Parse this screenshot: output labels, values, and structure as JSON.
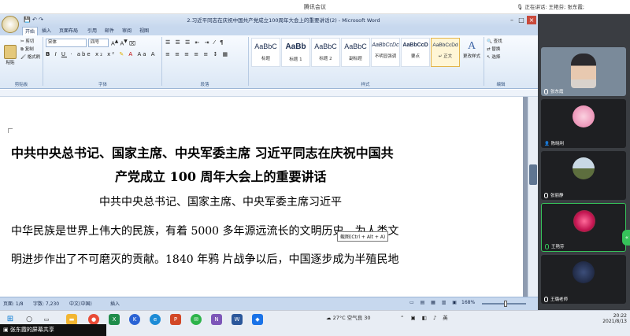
{
  "meeting": {
    "app_title": "腾讯会议",
    "speaking_label": "正在讲话: 王艳芬; 张东霞;"
  },
  "word": {
    "doc_title": "2.习近平同志在庆祝中国共产党成立100周年大会上的重要讲话(2) - Microsoft Word",
    "tabs": [
      "开始",
      "插入",
      "页面布局",
      "引用",
      "邮件",
      "审阅",
      "视图"
    ],
    "active_tab": "开始",
    "clipboard": {
      "paste": "粘贴",
      "cut": "剪切",
      "copy": "复制",
      "format_painter": "格式刷",
      "group": "剪贴板"
    },
    "font": {
      "name": "宋体",
      "size": "四号",
      "group": "字体"
    },
    "paragraph": {
      "group": "段落"
    },
    "styles": {
      "group": "样式",
      "items": [
        {
          "sample": "AaBbC",
          "name": "标题"
        },
        {
          "sample": "AaBb",
          "name": "标题 1"
        },
        {
          "sample": "AaBbC",
          "name": "标题 2"
        },
        {
          "sample": "AaBbC",
          "name": "副标题"
        },
        {
          "sample": "AaBbCcDc",
          "name": "不明显强调"
        },
        {
          "sample": "AaBbCcD",
          "name": "要点"
        },
        {
          "sample": "AaBbCcDd",
          "name": "↵ 正文"
        }
      ],
      "change_styles": "更改样式"
    },
    "editing": {
      "find": "查找",
      "replace": "替换",
      "select": "选择",
      "group": "编辑"
    },
    "document": {
      "heading_line1": "中共中央总书记、国家主席、中央军委主席 习近平同志在庆祝中国共",
      "heading_line2": "产党成立 100 周年大会上的重要讲话",
      "byline": "中共中央总书记、国家主席、中央军委主席习近平",
      "para_line1": "中华民族是世界上伟大的民族，有着 5000 多年源远流长的文明历史，为人类文",
      "para_line2": "明进步作出了不可磨灭的贡献。1840 年鸦 片战争以后，中国逐步成为半殖民地"
    },
    "tooltip": "截图(Ctrl + Alt + A)",
    "status": {
      "page": "页面: 1/8",
      "words": "字数: 7,230",
      "language": "中文(中国)",
      "mode": "插入",
      "zoom": "168%"
    }
  },
  "participants": [
    {
      "name": "张东霞",
      "kind": "video"
    },
    {
      "name": "陈晓利",
      "kind": "flower"
    },
    {
      "name": "张丽静",
      "kind": "landscape"
    },
    {
      "name": "王艳芬",
      "kind": "rose"
    },
    {
      "name": "王璐老师",
      "kind": "dark"
    }
  ],
  "taskbar": {
    "weather": "27°C 空气良 30",
    "time": "20:22",
    "date": "2021/8/13",
    "share_label": "张东霞的屏幕共享"
  }
}
